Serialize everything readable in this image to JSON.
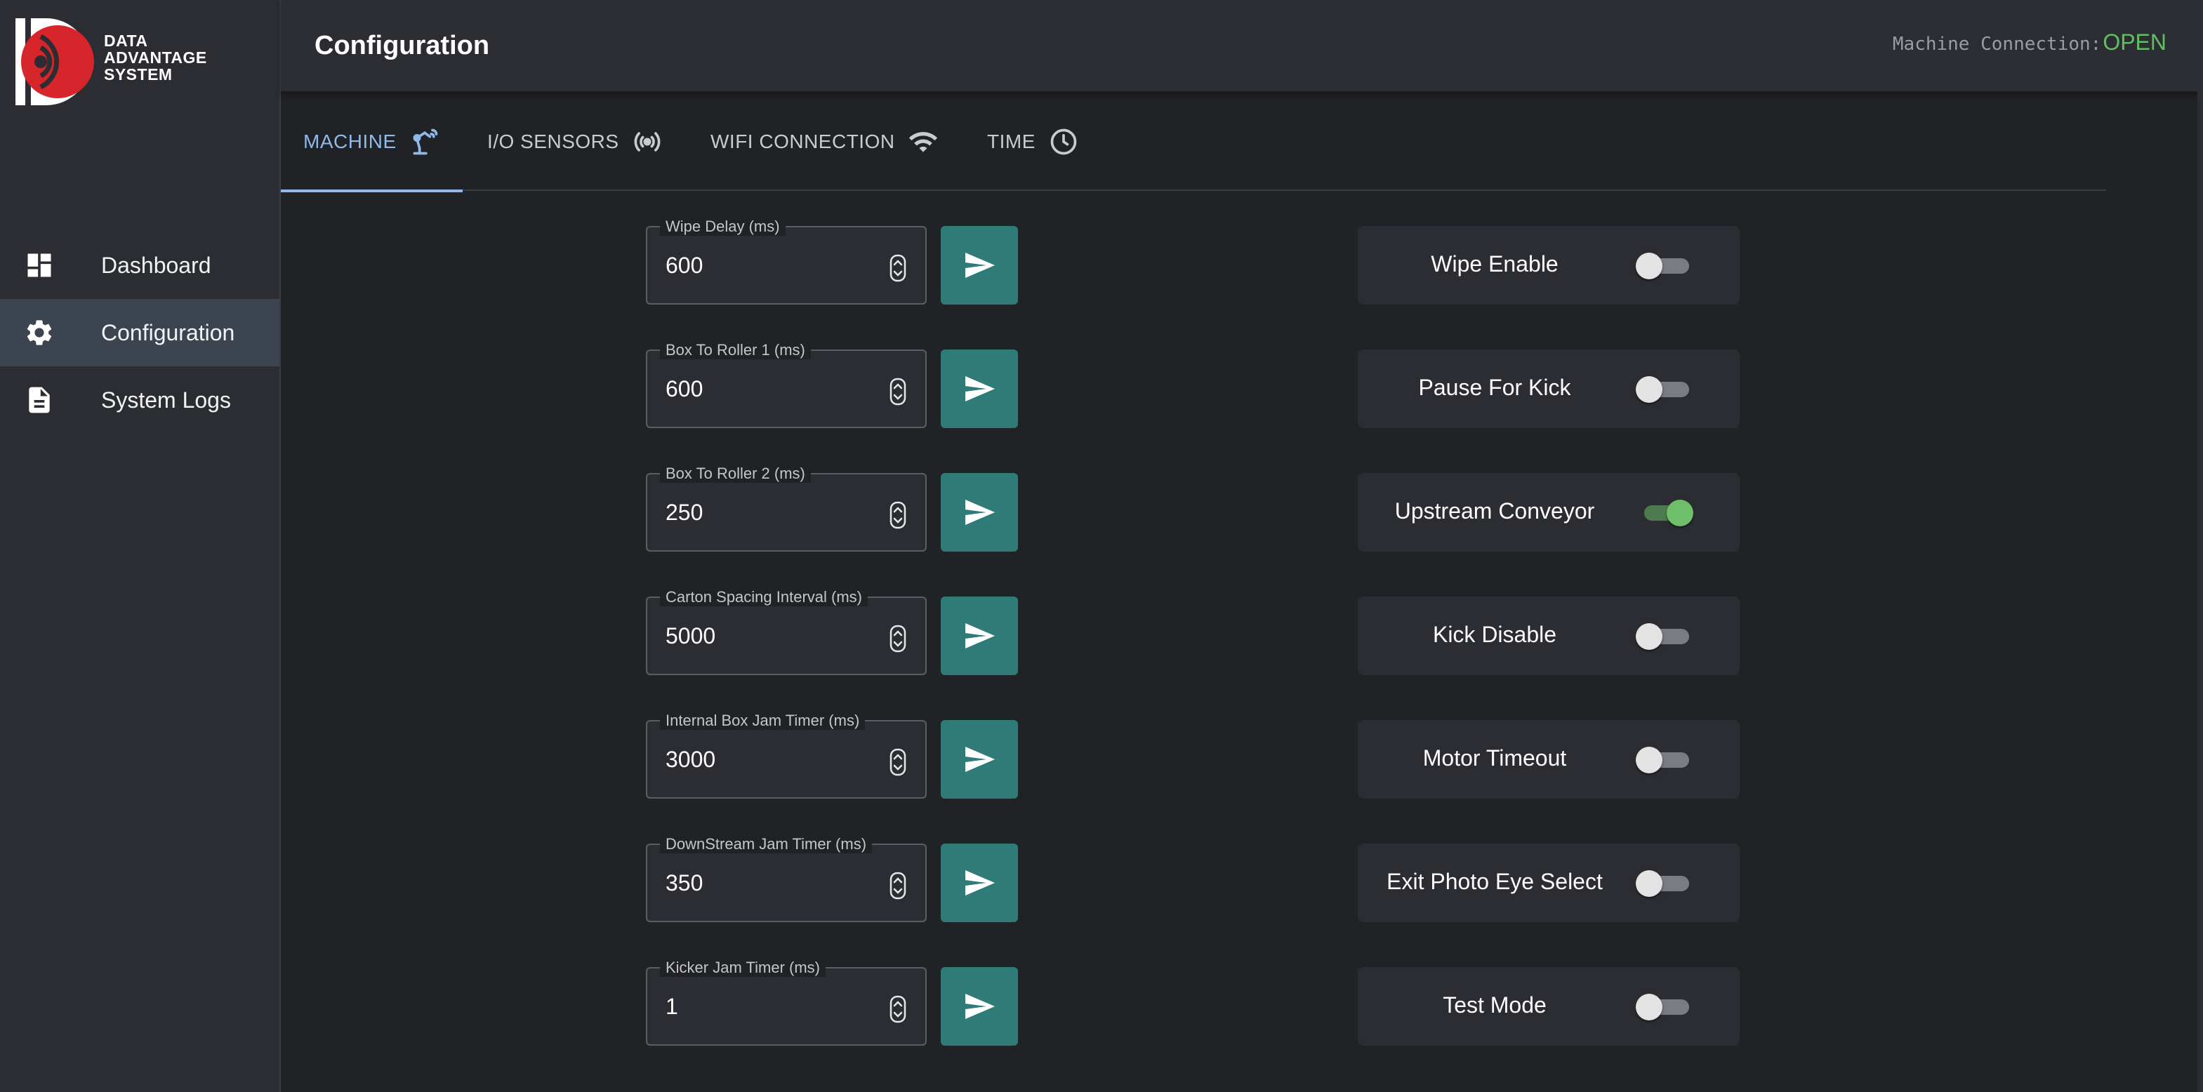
{
  "brand": {
    "line1": "DATA",
    "line2": "ADVANTAGE",
    "line3": "SYSTEM",
    "accent": "#d6262b"
  },
  "sidebar": {
    "items": [
      {
        "label": "Dashboard",
        "icon": "dashboard-icon"
      },
      {
        "label": "Configuration",
        "icon": "gear-icon",
        "active": true
      },
      {
        "label": "System Logs",
        "icon": "document-icon"
      }
    ]
  },
  "header": {
    "title": "Configuration",
    "connection_label": "Machine Connection:",
    "connection_status": "OPEN",
    "connection_color": "#5fbf62"
  },
  "tabs": [
    {
      "label": "MACHINE",
      "icon": "robot-arm-icon",
      "active": true
    },
    {
      "label": "I/O SENSORS",
      "icon": "sensor-broadcast-icon"
    },
    {
      "label": "WIFI CONNECTION",
      "icon": "wifi-icon"
    },
    {
      "label": "TIME",
      "icon": "clock-icon"
    }
  ],
  "fields": [
    {
      "label": "Wipe Delay (ms)",
      "value": "600"
    },
    {
      "label": "Box To Roller 1 (ms)",
      "value": "600"
    },
    {
      "label": "Box To Roller 2 (ms)",
      "value": "250"
    },
    {
      "label": "Carton Spacing Interval (ms)",
      "value": "5000"
    },
    {
      "label": "Internal Box Jam Timer (ms)",
      "value": "3000"
    },
    {
      "label": "DownStream Jam Timer (ms)",
      "value": "350"
    },
    {
      "label": "Kicker Jam Timer (ms)",
      "value": "1"
    }
  ],
  "toggles": [
    {
      "label": "Wipe Enable",
      "on": false
    },
    {
      "label": "Pause For Kick",
      "on": false
    },
    {
      "label": "Upstream Conveyor",
      "on": true
    },
    {
      "label": "Kick Disable",
      "on": false
    },
    {
      "label": "Motor Timeout",
      "on": false
    },
    {
      "label": "Exit Photo Eye Select",
      "on": false
    },
    {
      "label": "Test Mode",
      "on": false
    }
  ],
  "colors": {
    "send_button": "#2e7b77",
    "tab_active": "#90b9e8",
    "toggle_on": "#6fbf6a"
  }
}
